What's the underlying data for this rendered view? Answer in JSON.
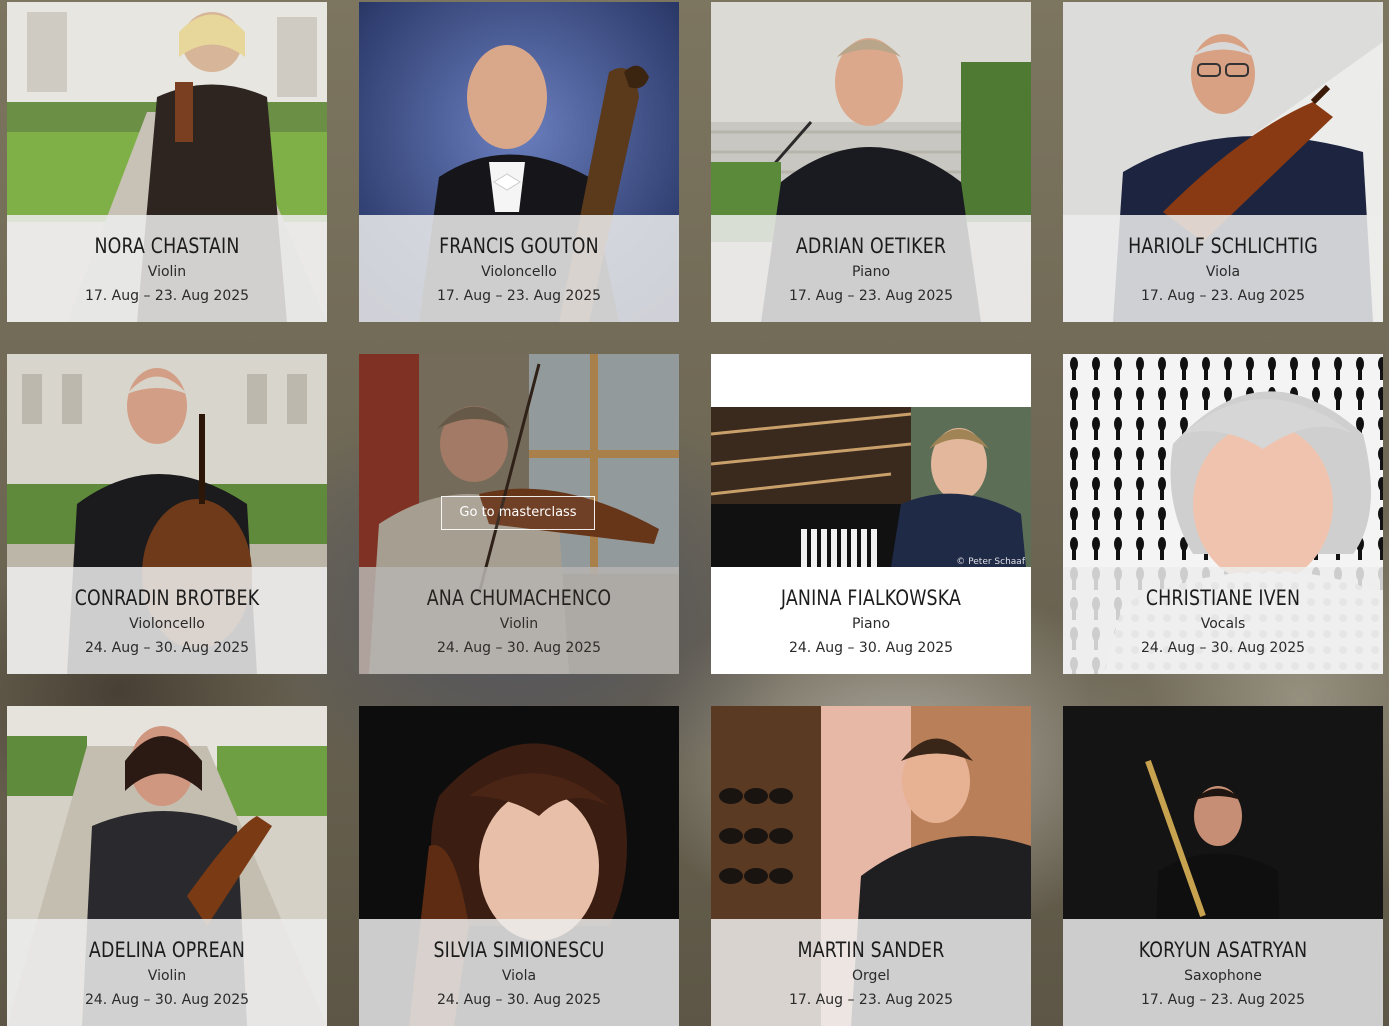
{
  "masterclasses": [
    {
      "name": "NORA CHASTAIN",
      "instrument": "Violin",
      "dates": "17. Aug – 23. Aug 2025"
    },
    {
      "name": "FRANCIS GOUTON",
      "instrument": "Violoncello",
      "dates": "17. Aug – 23. Aug 2025"
    },
    {
      "name": "ADRIAN OETIKER",
      "instrument": "Piano",
      "dates": "17. Aug – 23. Aug 2025"
    },
    {
      "name": "HARIOLF SCHLICHTIG",
      "instrument": "Viola",
      "dates": "17. Aug – 23. Aug 2025"
    },
    {
      "name": "CONRADIN BROTBEK",
      "instrument": "Violoncello",
      "dates": "24. Aug – 30. Aug 2025"
    },
    {
      "name": "ANA CHUMACHENCO",
      "instrument": "Violin",
      "dates": "24. Aug – 30. Aug 2025"
    },
    {
      "name": "JANINA FIALKOWSKA",
      "instrument": "Piano",
      "dates": "24. Aug – 30. Aug 2025"
    },
    {
      "name": "CHRISTIANE IVEN",
      "instrument": "Vocals",
      "dates": "24. Aug – 30. Aug 2025"
    },
    {
      "name": "ADELINA OPREAN",
      "instrument": "Violin",
      "dates": "24. Aug – 30. Aug 2025"
    },
    {
      "name": "SILVIA SIMIONESCU",
      "instrument": "Viola",
      "dates": "24. Aug – 30. Aug 2025"
    },
    {
      "name": "MARTIN SANDER",
      "instrument": "Orgel",
      "dates": "17. Aug – 23. Aug 2025"
    },
    {
      "name": "KORYUN ASATRYAN",
      "instrument": "Saxophone",
      "dates": "17. Aug – 23. Aug 2025"
    }
  ],
  "hover_button_label": "Go to masterclass",
  "photo_credit": "© Peter Schaaf"
}
